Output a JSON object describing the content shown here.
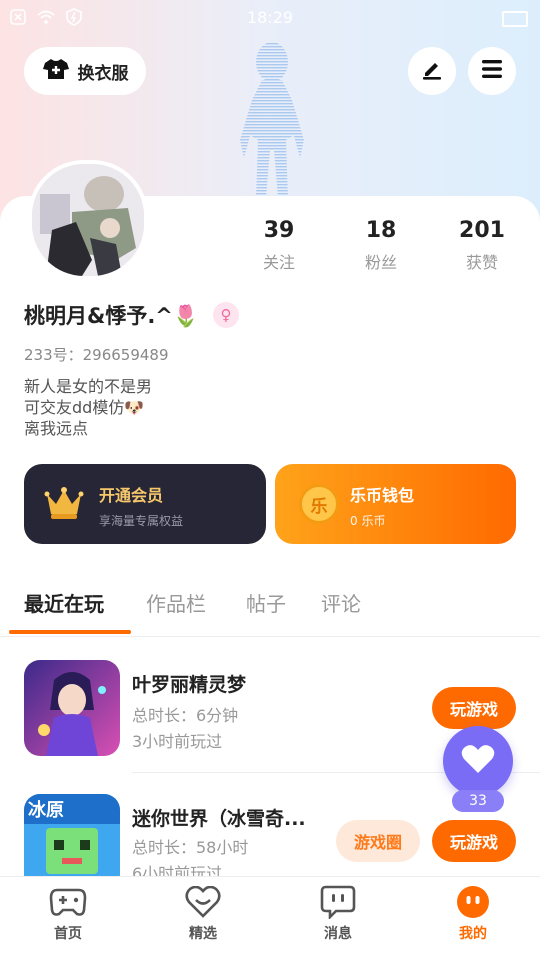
{
  "status": {
    "time": "18:29"
  },
  "header": {
    "wardrobe_label": "换衣服"
  },
  "profile": {
    "name": "桃明月&悸予.^🌷",
    "gender_symbol": "♀",
    "uid": "233号：296659489",
    "bio": [
      "新人是女的不是男",
      "可交友dd模仿🐶",
      "离我远点"
    ],
    "stats": [
      {
        "num": "39",
        "label": "关注"
      },
      {
        "num": "18",
        "label": "粉丝"
      },
      {
        "num": "201",
        "label": "获赞"
      }
    ]
  },
  "vip": {
    "title": "开通会员",
    "subtitle": "享海量专属权益"
  },
  "wallet": {
    "title": "乐币钱包",
    "subtitle": "0 乐币",
    "coin": "乐"
  },
  "tabs": [
    "最近在玩",
    "作品栏",
    "帖子",
    "评论"
  ],
  "games": [
    {
      "title": "叶罗丽精灵梦",
      "duration": "总时长：6分钟",
      "last": "3小时前玩过",
      "play": "玩游戏"
    },
    {
      "title": "迷你世界（冰雪奇...",
      "duration": "总时长：58小时",
      "last": "6小时前玩过",
      "play": "玩游戏",
      "circle": "游戏圈",
      "icon_text": "冰原"
    }
  ],
  "fab": {
    "count": "33"
  },
  "nav": [
    "首页",
    "精选",
    "消息",
    "我的"
  ],
  "colors": {
    "accent": "#ff6a00",
    "fab": "#7b6cf6",
    "vip_bg": "#262636"
  }
}
